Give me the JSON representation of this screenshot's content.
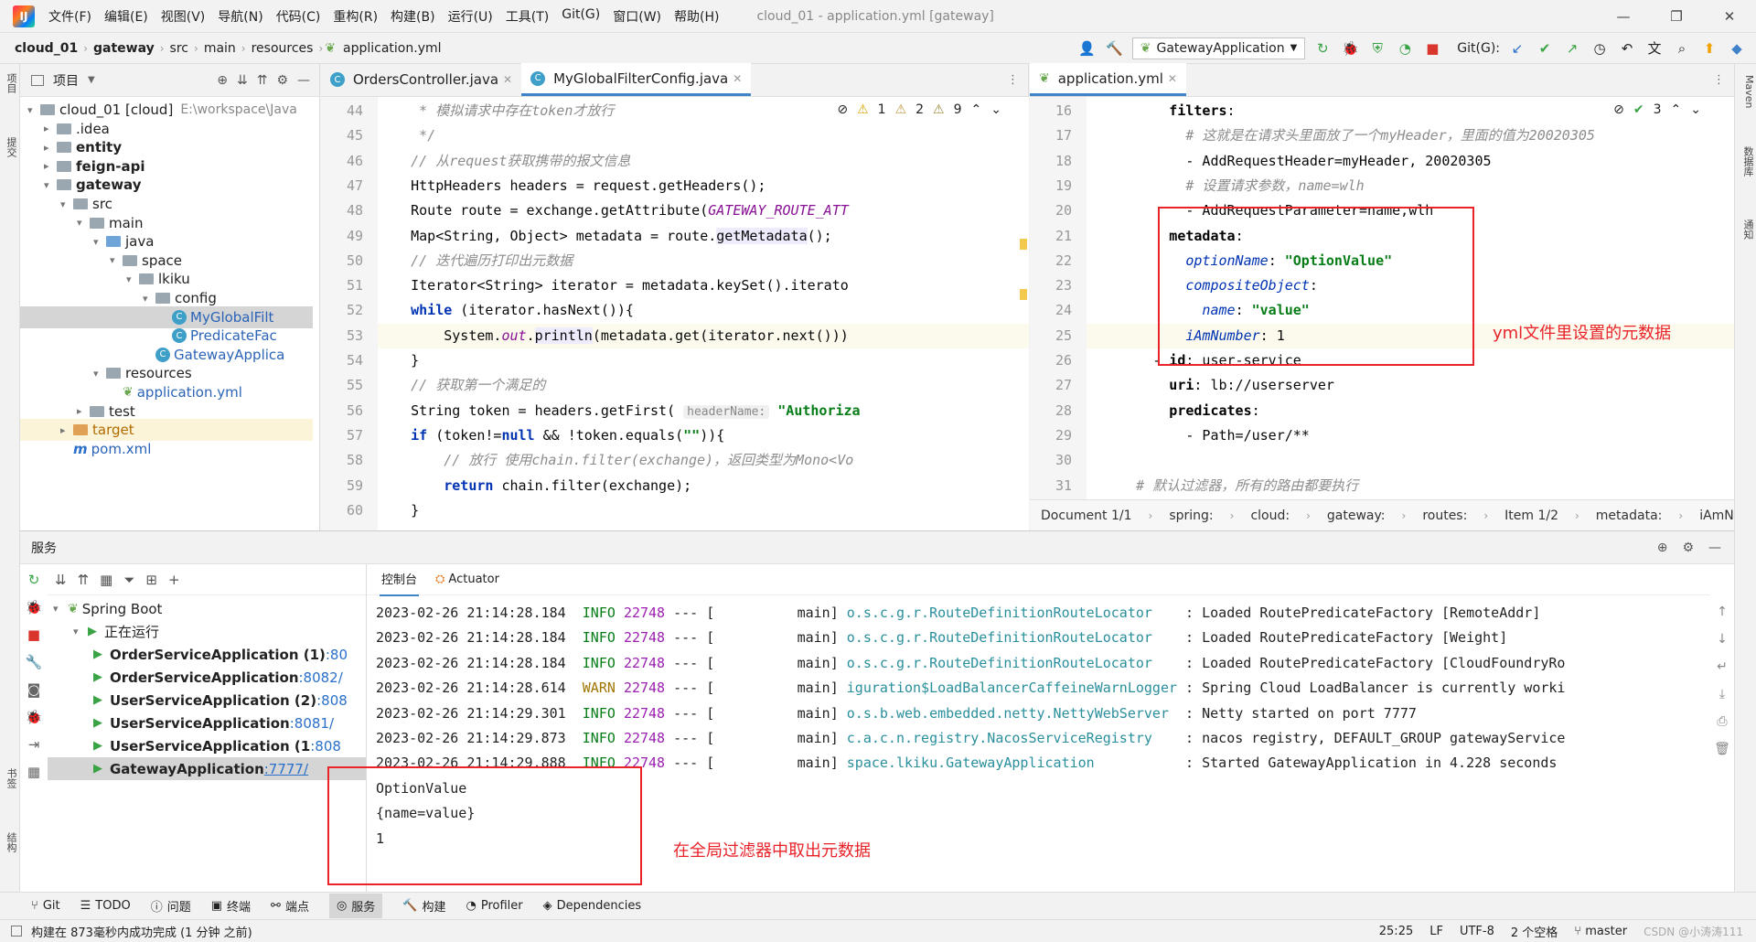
{
  "menu": [
    "文件(F)",
    "编辑(E)",
    "视图(V)",
    "导航(N)",
    "代码(C)",
    "重构(R)",
    "构建(B)",
    "运行(U)",
    "工具(T)",
    "Git(G)",
    "窗口(W)",
    "帮助(H)"
  ],
  "window_title": "cloud_01 - application.yml [gateway]",
  "breadcrumb": [
    "cloud_01",
    "gateway",
    "src",
    "main",
    "resources",
    "application.yml"
  ],
  "run_config": "GatewayApplication",
  "git_label": "Git(G):",
  "left_strip": [
    "项目",
    "提交",
    "书签",
    "结构"
  ],
  "right_strip": [
    "Maven",
    "数据库",
    "通知"
  ],
  "project": {
    "title": "项目",
    "tree": [
      {
        "label": "cloud_01 [cloud]",
        "extra": "E:\\workspace\\Java",
        "depth": 0,
        "arrow": "▾",
        "icon": "folder"
      },
      {
        "label": ".idea",
        "depth": 1,
        "arrow": "▸",
        "icon": "folder"
      },
      {
        "label": "entity",
        "depth": 1,
        "arrow": "▸",
        "icon": "folder",
        "bold": true
      },
      {
        "label": "feign-api",
        "depth": 1,
        "arrow": "▸",
        "icon": "folder",
        "bold": true
      },
      {
        "label": "gateway",
        "depth": 1,
        "arrow": "▾",
        "icon": "folder",
        "bold": true
      },
      {
        "label": "src",
        "depth": 2,
        "arrow": "▾",
        "icon": "folder"
      },
      {
        "label": "main",
        "depth": 3,
        "arrow": "▾",
        "icon": "folder"
      },
      {
        "label": "java",
        "depth": 4,
        "arrow": "▾",
        "icon": "blue"
      },
      {
        "label": "space",
        "depth": 5,
        "arrow": "▾",
        "icon": "folder"
      },
      {
        "label": "lkiku",
        "depth": 6,
        "arrow": "▾",
        "icon": "folder"
      },
      {
        "label": "config",
        "depth": 7,
        "arrow": "▾",
        "icon": "folder"
      },
      {
        "label": "MyGlobalFilt",
        "depth": 8,
        "arrow": "",
        "icon": "class",
        "selected": true
      },
      {
        "label": "PredicateFac",
        "depth": 8,
        "arrow": "",
        "icon": "class"
      },
      {
        "label": "GatewayApplica",
        "depth": 7,
        "arrow": "",
        "icon": "class"
      },
      {
        "label": "resources",
        "depth": 4,
        "arrow": "▾",
        "icon": "folder"
      },
      {
        "label": "application.yml",
        "depth": 5,
        "arrow": "",
        "icon": "leaf"
      },
      {
        "label": "test",
        "depth": 3,
        "arrow": "▸",
        "icon": "folder"
      },
      {
        "label": "target",
        "depth": 2,
        "arrow": "▸",
        "icon": "orange",
        "target": true
      },
      {
        "label": "pom.xml",
        "depth": 2,
        "arrow": "",
        "icon": "m"
      }
    ]
  },
  "left_editor": {
    "tabs": [
      "OrdersController.java",
      "MyGlobalFilterConfig.java"
    ],
    "inspections": {
      "warn_a": "1",
      "warn_b": "2",
      "weak": "9"
    },
    "lines": [
      {
        "n": "44",
        "segs": [
          [
            "cmt",
            "     * 模拟请求中存在token才放行"
          ]
        ]
      },
      {
        "n": "45",
        "segs": [
          [
            "cmt",
            "     */"
          ]
        ]
      },
      {
        "n": "46",
        "segs": [
          [
            "cmt",
            "    // 从request获取携带的报文信息"
          ]
        ]
      },
      {
        "n": "47",
        "segs": [
          [
            "",
            "    HttpHeaders headers = request.getHeaders();"
          ]
        ]
      },
      {
        "n": "48",
        "segs": [
          [
            "",
            "    Route route = exchange.getAttribute("
          ],
          [
            "fld",
            "GATEWAY_ROUTE_ATT"
          ]
        ]
      },
      {
        "n": "49",
        "segs": [
          [
            "",
            "    Map<String, Object> metadata = route."
          ],
          [
            "hl",
            "getMetadata"
          ],
          [
            "",
            "();"
          ]
        ]
      },
      {
        "n": "50",
        "segs": [
          [
            "cmt",
            "    // 迭代遍历打印出元数据"
          ]
        ]
      },
      {
        "n": "51",
        "segs": [
          [
            "",
            "    Iterator<String> iterator = metadata.keySet().iterato"
          ]
        ]
      },
      {
        "n": "52",
        "segs": [
          [
            "kw",
            "    while"
          ],
          [
            "",
            " (iterator.hasNext()){"
          ]
        ]
      },
      {
        "n": "53",
        "segs": [
          [
            "",
            "        System."
          ],
          [
            "fld",
            "out"
          ],
          [
            "",
            "."
          ],
          [
            "hl",
            "println"
          ],
          [
            "",
            "(metadata.get(iterator.next()))"
          ]
        ],
        "cur": true
      },
      {
        "n": "54",
        "segs": [
          [
            "",
            "    }"
          ]
        ]
      },
      {
        "n": "55",
        "segs": [
          [
            "cmt",
            "    // 获取第一个满足的"
          ]
        ]
      },
      {
        "n": "56",
        "segs": [
          [
            "",
            "    String token = headers.getFirst( "
          ],
          [
            "hint",
            "headerName:"
          ],
          [
            "",
            " "
          ],
          [
            "str",
            "\"Authoriza"
          ]
        ]
      },
      {
        "n": "57",
        "segs": [
          [
            "kw",
            "    if"
          ],
          [
            "",
            " (token!="
          ],
          [
            "kw",
            "null"
          ],
          [
            "",
            " && !token.equals("
          ],
          [
            "str",
            "\"\""
          ],
          [
            "",
            ")){"
          ]
        ]
      },
      {
        "n": "58",
        "segs": [
          [
            "cmt",
            "        // 放行 使用chain.filter(exchange)，返回类型为Mono<Vo"
          ]
        ]
      },
      {
        "n": "59",
        "segs": [
          [
            "kw",
            "        return"
          ],
          [
            "",
            " chain.filter(exchange);"
          ]
        ]
      },
      {
        "n": "60",
        "segs": [
          [
            "",
            "    }"
          ]
        ]
      }
    ]
  },
  "right_editor": {
    "tabs": [
      "application.yml"
    ],
    "inspections": {
      "ok": "3"
    },
    "lines": [
      {
        "n": "16",
        "segs": [
          [
            "ykey",
            "          filters"
          ],
          [
            "",
            ":"
          ]
        ]
      },
      {
        "n": "17",
        "segs": [
          [
            "cmt",
            "            # 这就是在请求头里面放了一个myHeader，里面的值为20020305"
          ]
        ]
      },
      {
        "n": "18",
        "segs": [
          [
            "",
            "            - AddRequestHeader=myHeader, 20020305"
          ]
        ]
      },
      {
        "n": "19",
        "segs": [
          [
            "cmt",
            "            # 设置请求参数，name=wlh"
          ]
        ]
      },
      {
        "n": "20",
        "segs": [
          [
            "",
            "            - AddRequestParameter=name,wlh"
          ]
        ]
      },
      {
        "n": "21",
        "segs": [
          [
            "ykey",
            "          metadata"
          ],
          [
            "",
            ":"
          ]
        ]
      },
      {
        "n": "22",
        "segs": [
          [
            "ykey2",
            "            optionName"
          ],
          [
            "",
            ": "
          ],
          [
            "yval",
            "\"OptionValue\""
          ]
        ]
      },
      {
        "n": "23",
        "segs": [
          [
            "ykey2",
            "            compositeObject"
          ],
          [
            "",
            ":"
          ]
        ]
      },
      {
        "n": "24",
        "segs": [
          [
            "ykey2",
            "              name"
          ],
          [
            "",
            ": "
          ],
          [
            "yval",
            "\"value\""
          ]
        ]
      },
      {
        "n": "25",
        "segs": [
          [
            "ykey2",
            "            iAmNumber"
          ],
          [
            "",
            ": 1"
          ]
        ],
        "cur": true
      },
      {
        "n": "26",
        "segs": [
          [
            "",
            "        - "
          ],
          [
            "ykey",
            "id"
          ],
          [
            "",
            ": user-service"
          ]
        ]
      },
      {
        "n": "27",
        "segs": [
          [
            "ykey",
            "          uri"
          ],
          [
            "",
            ": lb://userserver"
          ]
        ]
      },
      {
        "n": "28",
        "segs": [
          [
            "ykey",
            "          predicates"
          ],
          [
            "",
            ":"
          ]
        ]
      },
      {
        "n": "29",
        "segs": [
          [
            "",
            "            - Path=/user/**"
          ]
        ]
      },
      {
        "n": "30",
        "segs": [
          [
            "",
            ""
          ]
        ]
      },
      {
        "n": "31",
        "segs": [
          [
            "cmt",
            "      # 默认过滤器，所有的路由都要执行"
          ]
        ]
      }
    ],
    "yaml_breadcrumb": [
      "Document 1/1",
      "spring:",
      "cloud:",
      "gateway:",
      "routes:",
      "Item 1/2",
      "metadata:",
      "iAmNumber:"
    ]
  },
  "services": {
    "title": "服务",
    "tabs": [
      "控制台",
      "Actuator"
    ],
    "tree": [
      {
        "label": "Spring Boot",
        "depth": 0,
        "arrow": "▾"
      },
      {
        "label": "正在运行",
        "depth": 1,
        "arrow": "▾"
      },
      {
        "label": "OrderServiceApplication (1)",
        "port": ":80",
        "depth": 2,
        "bold": true
      },
      {
        "label": "OrderServiceApplication",
        "port": ":8082/",
        "depth": 2,
        "bold": true
      },
      {
        "label": "UserServiceApplication (2)",
        "port": ":808",
        "depth": 2,
        "bold": true
      },
      {
        "label": "UserServiceApplication",
        "port": ":8081/",
        "depth": 2,
        "bold": true
      },
      {
        "label": "UserServiceApplication (1",
        "port": ":808",
        "depth": 2,
        "bold": true
      },
      {
        "label": "GatewayApplication",
        "port": ":7777/",
        "depth": 2,
        "bold": true,
        "selected": true
      }
    ],
    "log": [
      {
        "ts": "2023-02-26 21:14:28.184",
        "lvl": "INFO",
        "pid": "22748",
        "thread": "main]",
        "logger": "o.s.c.g.r.RouteDefinitionRouteLocator   ",
        "msg": ": Loaded RoutePredicateFactory [RemoteAddr]"
      },
      {
        "ts": "2023-02-26 21:14:28.184",
        "lvl": "INFO",
        "pid": "22748",
        "thread": "main]",
        "logger": "o.s.c.g.r.RouteDefinitionRouteLocator   ",
        "msg": ": Loaded RoutePredicateFactory [Weight]"
      },
      {
        "ts": "2023-02-26 21:14:28.184",
        "lvl": "INFO",
        "pid": "22748",
        "thread": "main]",
        "logger": "o.s.c.g.r.RouteDefinitionRouteLocator   ",
        "msg": ": Loaded RoutePredicateFactory [CloudFoundryRo"
      },
      {
        "ts": "2023-02-26 21:14:28.614",
        "lvl": "WARN",
        "pid": "22748",
        "thread": "main]",
        "logger": "iguration$LoadBalancerCaffeineWarnLogger",
        "msg": ": Spring Cloud LoadBalancer is currently worki"
      },
      {
        "ts": "2023-02-26 21:14:29.301",
        "lvl": "INFO",
        "pid": "22748",
        "thread": "main]",
        "logger": "o.s.b.web.embedded.netty.NettyWebServer ",
        "msg": ": Netty started on port 7777"
      },
      {
        "ts": "2023-02-26 21:14:29.873",
        "lvl": "INFO",
        "pid": "22748",
        "thread": "main]",
        "logger": "c.a.c.n.registry.NacosServiceRegistry   ",
        "msg": ": nacos registry, DEFAULT_GROUP gatewayService"
      },
      {
        "ts": "2023-02-26 21:14:29.888",
        "lvl": "INFO",
        "pid": "22748",
        "thread": "main]",
        "logger": "space.lkiku.GatewayApplication          ",
        "msg": ": Started GatewayApplication in 4.228 seconds"
      }
    ],
    "output": [
      "OptionValue",
      "{name=value}",
      "1"
    ]
  },
  "annotations": {
    "yml": "yml文件里设置的元数据",
    "filter": "在全局过滤器中取出元数据"
  },
  "tool_tabs": [
    "Git",
    "TODO",
    "问题",
    "终端",
    "端点",
    "服务",
    "构建",
    "Profiler",
    "Dependencies"
  ],
  "status": {
    "message": "构建在 873毫秒内成功完成 (1 分钟 之前)",
    "position": "25:25",
    "line_sep": "LF",
    "encoding": "UTF-8",
    "indent": "2 个空格",
    "branch": "master",
    "watermark": "CSDN @小涛涛111"
  },
  "colors": {
    "accent": "#4083c9",
    "annotation": "#e8232a",
    "run_green": "#3aa345"
  }
}
